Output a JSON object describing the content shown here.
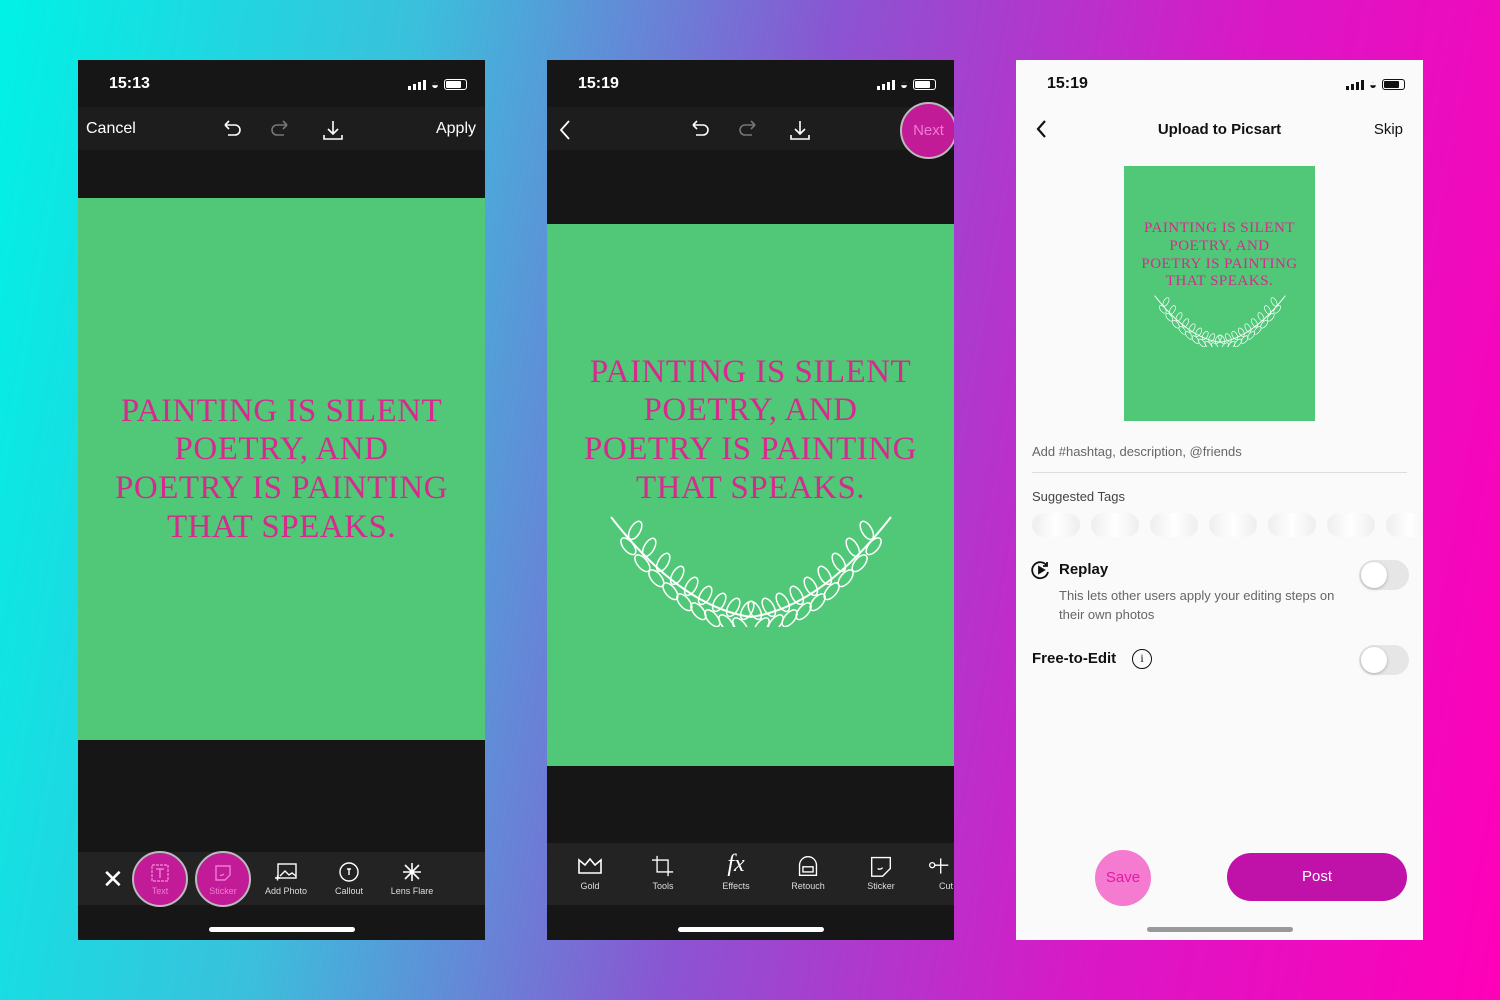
{
  "quote_lines": [
    "PAINTING IS SILENT",
    "POETRY, AND",
    "POETRY IS PAINTING",
    "THAT SPEAKS."
  ],
  "colors": {
    "canvas": "#50c878",
    "quote": "#d62a8f",
    "accent": "#c21b97"
  },
  "phone1": {
    "time": "15:13",
    "cancel": "Cancel",
    "apply": "Apply",
    "tools": [
      {
        "label": "Text",
        "icon": "text-icon"
      },
      {
        "label": "Sticker",
        "icon": "sticker-icon"
      },
      {
        "label": "Add Photo",
        "icon": "add-photo-icon"
      },
      {
        "label": "Callout",
        "icon": "callout-icon"
      },
      {
        "label": "Lens Flare",
        "icon": "lens-flare-icon"
      }
    ]
  },
  "phone2": {
    "time": "15:19",
    "next": "Next",
    "tools": [
      {
        "label": "Gold",
        "icon": "crown-icon"
      },
      {
        "label": "Tools",
        "icon": "crop-icon"
      },
      {
        "label": "Effects",
        "icon": "fx-icon"
      },
      {
        "label": "Retouch",
        "icon": "retouch-icon"
      },
      {
        "label": "Sticker",
        "icon": "sticker-icon"
      },
      {
        "label": "Cut",
        "icon": "cutout-icon"
      }
    ]
  },
  "phone3": {
    "time": "15:19",
    "title": "Upload to Picsart",
    "skip": "Skip",
    "description_placeholder": "Add #hashtag, description, @friends",
    "suggested_tags": "Suggested Tags",
    "replay": {
      "label": "Replay",
      "description": "This lets other users apply your editing steps on their own photos",
      "on": false
    },
    "free_to_edit": {
      "label": "Free-to-Edit",
      "on": false
    },
    "save": "Save",
    "post": "Post"
  }
}
